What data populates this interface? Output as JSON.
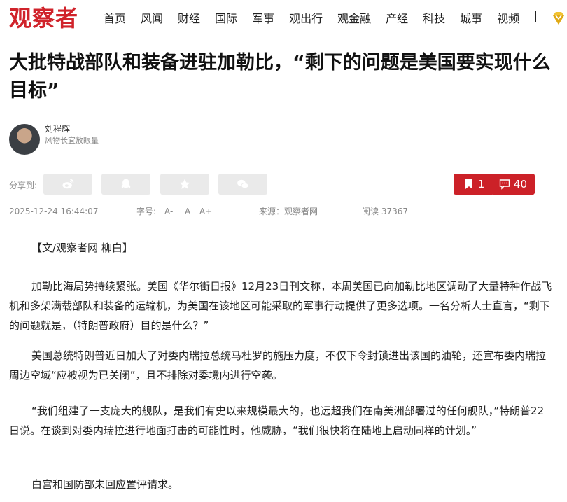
{
  "site": {
    "logo_text": "观察者",
    "brand_color": "#d0232b"
  },
  "nav": {
    "items": [
      "首页",
      "风闻",
      "财经",
      "国际",
      "军事",
      "观出行",
      "观金融",
      "产经",
      "科技",
      "城事",
      "视频"
    ],
    "separator": "|",
    "vip_icon": "gem-icon"
  },
  "article": {
    "title": "大批特战部队和装备进驻加勒比，“剩下的问题是美国要实现什么目标”",
    "author": {
      "name": "刘程辉",
      "description": "风物长宜放眼量"
    },
    "share": {
      "label": "分享到:",
      "buttons": [
        "weibo-icon",
        "qq-icon",
        "qzone-star-icon",
        "wechat-icon"
      ]
    },
    "actions": {
      "bookmark_count": "1",
      "comment_count": "40",
      "action_color": "#cc2128"
    },
    "meta": {
      "date": "2025-12-24 16:44:07",
      "font_size_label": "字号:",
      "font_size_options": [
        "A-",
        "A",
        "A+"
      ],
      "source": "来源：观察者网",
      "reads": "阅读 37367"
    },
    "paragraphs": [
      "【文/观察者网 柳白】",
      "加勒比海局势持续紧张。美国《华尔街日报》12月23日刊文称，本周美国已向加勒比地区调动了大量特种作战飞机和多架满载部队和装备的运输机，为美国在该地区可能采取的军事行动提供了更多选项。一名分析人士直言，“剩下的问题就是，（特朗普政府）目的是什么？”",
      "美国总统特朗普近日加大了对委内瑞拉总统马杜罗的施压力度，不仅下令封锁进出该国的油轮，还宣布委内瑞拉周边空域“应被视为已关闭”，且不排除对委境内进行空袭。",
      "“我们组建了一支庞大的舰队，是我们有史以来规模最大的，也远超我们在南美洲部署过的任何舰队，”特朗普22日说。在谈到对委内瑞拉进行地面打击的可能性时，他威胁，“我们很快将在陆地上启动同样的计划。”",
      "白宫和国防部未回应置评请求。"
    ]
  }
}
